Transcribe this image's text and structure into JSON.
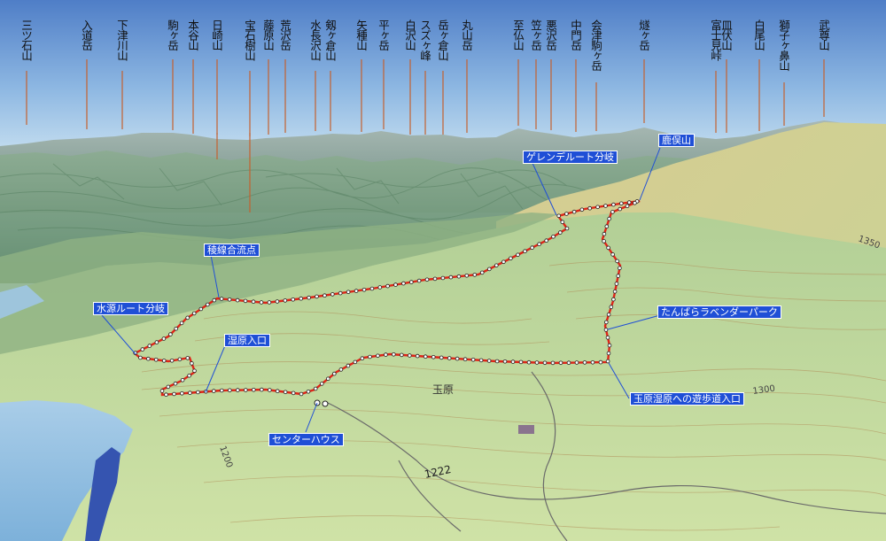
{
  "peaks": [
    {
      "name": "三ツ石山"
    },
    {
      "name": "入道岳"
    },
    {
      "name": "下津川山"
    },
    {
      "name": "駒ヶ岳"
    },
    {
      "name": "本谷山"
    },
    {
      "name": "日崎山"
    },
    {
      "name": "宝石樹山"
    },
    {
      "name": "藤原山"
    },
    {
      "name": "荒沢岳"
    },
    {
      "name": "水長沢山"
    },
    {
      "name": "剱ヶ倉山"
    },
    {
      "name": "矢種山"
    },
    {
      "name": "平ヶ岳"
    },
    {
      "name": "白沢山"
    },
    {
      "name": "スズヶ峰"
    },
    {
      "name": "岳ヶ倉山"
    },
    {
      "name": "丸山岳"
    },
    {
      "name": "至仏山"
    },
    {
      "name": "笠ヶ岳"
    },
    {
      "name": "悪沢岳"
    },
    {
      "name": "中門岳"
    },
    {
      "name": "会津駒ヶ岳"
    },
    {
      "name": "燧ヶ岳"
    },
    {
      "name": "富士見峠"
    },
    {
      "name": "皿伏山"
    },
    {
      "name": "白尾山"
    },
    {
      "name": "獅子ヶ鼻山"
    },
    {
      "name": "武尊山"
    }
  ],
  "labels": [
    {
      "text": "ゲレンデルート分岐"
    },
    {
      "text": "鹿俣山"
    },
    {
      "text": "稜線合流点"
    },
    {
      "text": "水源ルート分岐"
    },
    {
      "text": "たんばらラベンダーパーク"
    },
    {
      "text": "湿原入口"
    },
    {
      "text": "玉原湿原への遊歩道入口"
    },
    {
      "text": "センターハウス"
    }
  ],
  "map_text": {
    "place_tamahara": "玉原",
    "elev_1222": "1222",
    "elev_1300": "1300",
    "elev_1200": "1200",
    "elev_1350": "1350"
  }
}
